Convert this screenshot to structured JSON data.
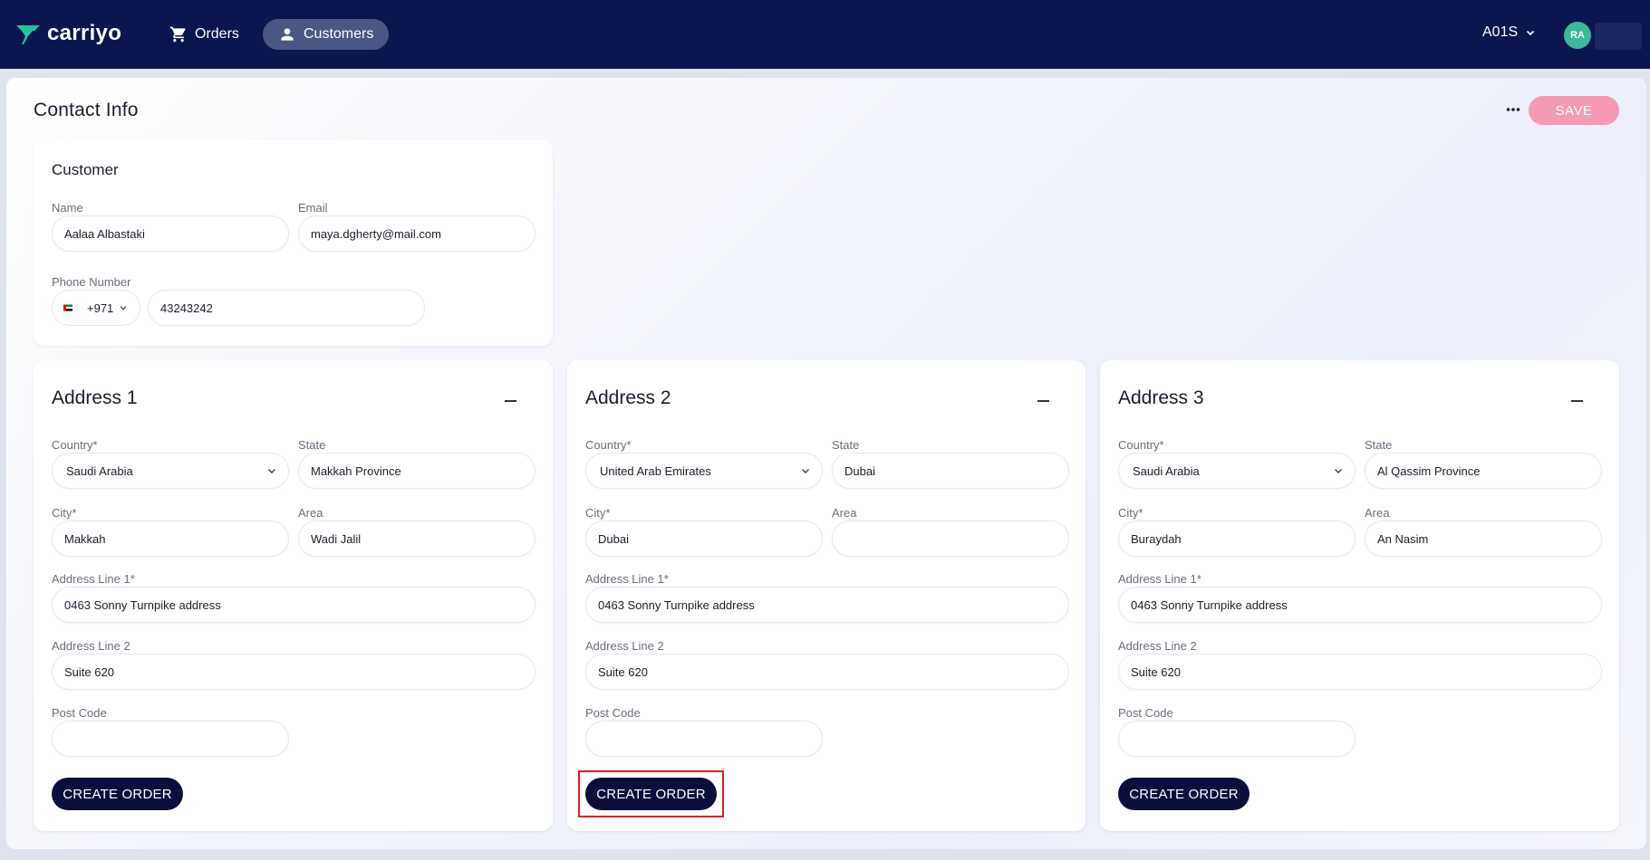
{
  "app": {
    "name": "carriyo"
  },
  "nav": {
    "items": [
      {
        "label": "Orders",
        "icon": "cart-icon"
      },
      {
        "label": "Customers",
        "icon": "person-icon",
        "active": true
      }
    ],
    "account_label": "A01S",
    "avatar_initials": "RA"
  },
  "page": {
    "title": "Contact Info",
    "save_label": "SAVE"
  },
  "customer": {
    "title": "Customer",
    "name_label": "Name",
    "name_value": "Aalaa Albastaki",
    "email_label": "Email",
    "email_value": "maya.dgherty@mail.com",
    "phone_label": "Phone Number",
    "phone_code": "+971",
    "phone_value": "43243242"
  },
  "address_labels": {
    "country": "Country*",
    "state": "State",
    "city": "City*",
    "area": "Area",
    "line1": "Address Line 1*",
    "line2": "Address Line 2",
    "post_code": "Post Code",
    "create_order": "CREATE ORDER"
  },
  "addresses": [
    {
      "title": "Address 1",
      "country": "Saudi Arabia",
      "state": "Makkah Province",
      "city": "Makkah",
      "area": "Wadi Jalil",
      "line1": "0463 Sonny Turnpike address",
      "line2": "Suite 620",
      "post_code": ""
    },
    {
      "title": "Address 2",
      "country": "United Arab Emirates",
      "state": "Dubai",
      "city": "Dubai",
      "area": "",
      "line1": "0463 Sonny Turnpike address",
      "line2": "Suite 620",
      "post_code": "",
      "highlighted": true
    },
    {
      "title": "Address 3",
      "country": "Saudi Arabia",
      "state": "Al Qassim Province",
      "city": "Buraydah",
      "area": "An Nasim",
      "line1": "0463 Sonny Turnpike address",
      "line2": "Suite 620",
      "post_code": ""
    }
  ],
  "colors": {
    "nav_bg": "#0b1650",
    "save_bg": "#f59ab4",
    "create_bg": "#0b0e3d",
    "highlight": "#e0201c",
    "avatar": "#3cb89a"
  }
}
